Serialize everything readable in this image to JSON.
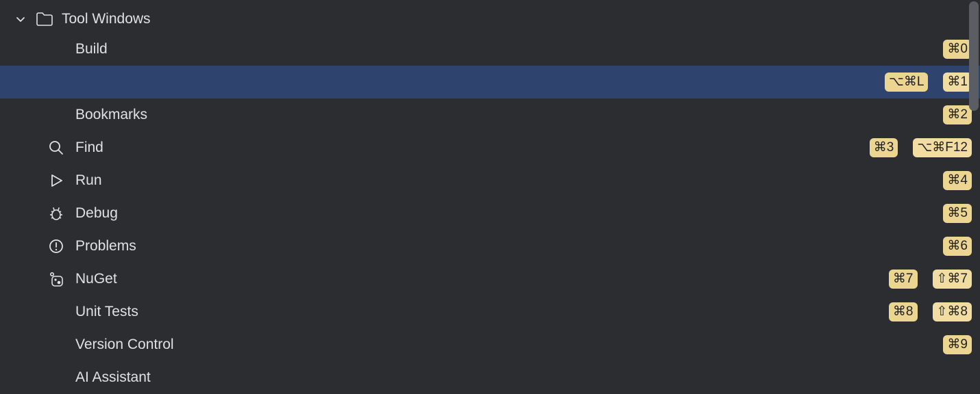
{
  "group": {
    "title": "Tool Windows"
  },
  "items": [
    {
      "label": "Build",
      "icon": null,
      "selected": false,
      "shortcuts": [
        "⌘0"
      ]
    },
    {
      "label": "",
      "icon": null,
      "selected": true,
      "shortcuts": [
        "⌥⌘L",
        "⌘1"
      ]
    },
    {
      "label": "Bookmarks",
      "icon": null,
      "selected": false,
      "shortcuts": [
        "⌘2"
      ]
    },
    {
      "label": "Find",
      "icon": "search",
      "selected": false,
      "shortcuts": [
        "⌘3",
        "⌥⌘F12"
      ]
    },
    {
      "label": "Run",
      "icon": "play",
      "selected": false,
      "shortcuts": [
        "⌘4"
      ]
    },
    {
      "label": "Debug",
      "icon": "bug",
      "selected": false,
      "shortcuts": [
        "⌘5"
      ]
    },
    {
      "label": "Problems",
      "icon": "warning",
      "selected": false,
      "shortcuts": [
        "⌘6"
      ]
    },
    {
      "label": "NuGet",
      "icon": "nuget",
      "selected": false,
      "shortcuts": [
        "⌘7",
        "⇧⌘7"
      ]
    },
    {
      "label": "Unit Tests",
      "icon": null,
      "selected": false,
      "shortcuts": [
        "⌘8",
        "⇧⌘8"
      ]
    },
    {
      "label": "Version Control",
      "icon": null,
      "selected": false,
      "shortcuts": [
        "⌘9"
      ]
    },
    {
      "label": "AI Assistant",
      "icon": null,
      "selected": false,
      "shortcuts": []
    }
  ]
}
